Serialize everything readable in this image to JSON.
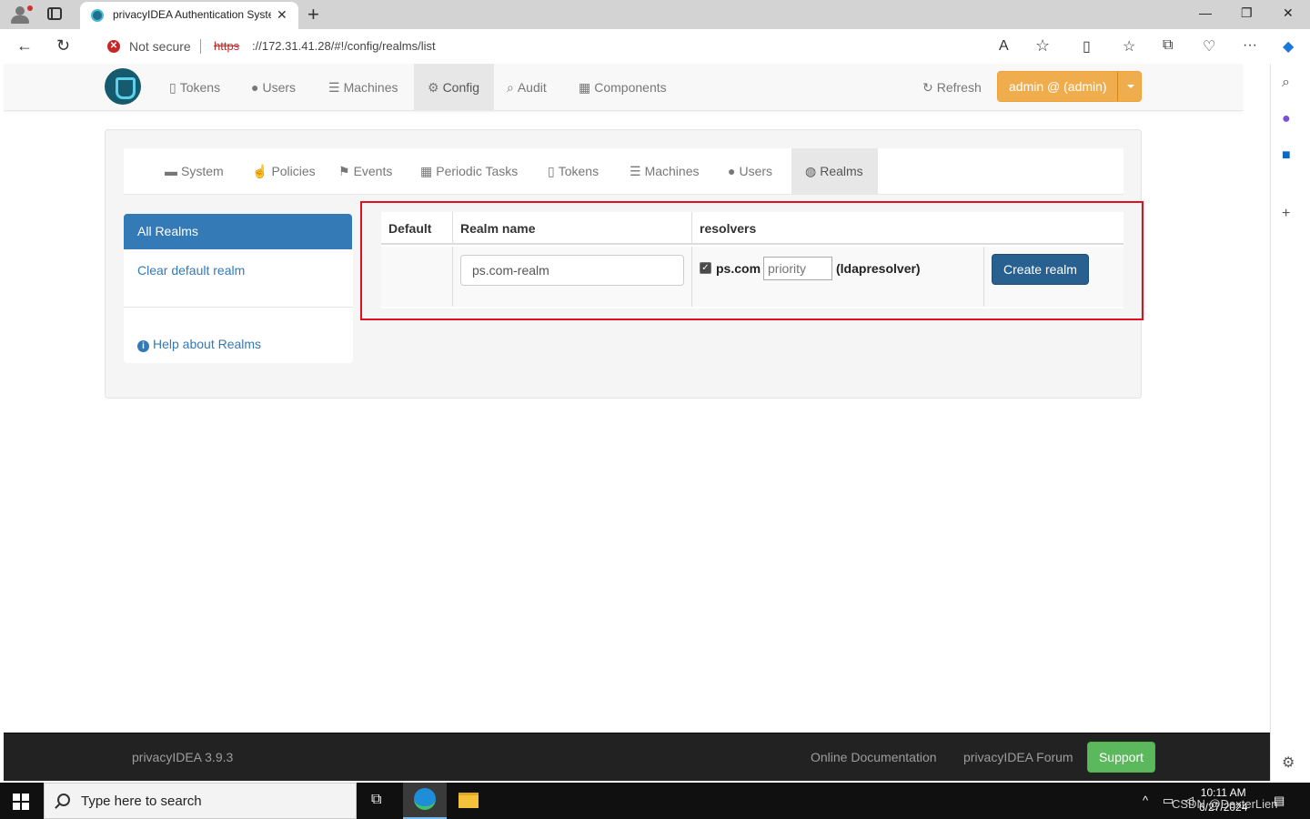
{
  "browser": {
    "tab_title": "privacyIDEA Authentication System",
    "not_secure": "Not secure",
    "url_scheme": "https",
    "url_rest": "://172.31.41.28/#!/config/realms/list"
  },
  "navbar": {
    "items": [
      {
        "label": "Tokens",
        "icon": "mobile-icon"
      },
      {
        "label": "Users",
        "icon": "user-icon"
      },
      {
        "label": "Machines",
        "icon": "list-icon"
      },
      {
        "label": "Config",
        "icon": "gear-icon"
      },
      {
        "label": "Audit",
        "icon": "search-icon"
      },
      {
        "label": "Components",
        "icon": "calendar-icon"
      }
    ],
    "refresh": "Refresh",
    "user": "admin @ (admin)"
  },
  "config_nav": {
    "items": [
      {
        "label": "System",
        "icon": "briefcase-icon"
      },
      {
        "label": "Policies",
        "icon": "hand-icon"
      },
      {
        "label": "Events",
        "icon": "flag-icon"
      },
      {
        "label": "Periodic Tasks",
        "icon": "calendar-icon"
      },
      {
        "label": "Tokens",
        "icon": "mobile-icon"
      },
      {
        "label": "Machines",
        "icon": "list-icon"
      },
      {
        "label": "Users",
        "icon": "user-icon"
      },
      {
        "label": "Realms",
        "icon": "globe-icon"
      }
    ]
  },
  "sidebar": {
    "all_realms": "All Realms",
    "clear_default": "Clear default realm",
    "help": "Help about Realms"
  },
  "realm_table": {
    "headers": [
      "Default",
      "Realm name",
      "resolvers"
    ],
    "realm_name_value": "ps.com-realm",
    "resolver_checked": true,
    "resolver_name": "ps.com",
    "priority_placeholder": "priority",
    "resolver_type": "(ldapresolver)",
    "create_button": "Create realm"
  },
  "footer": {
    "version": "privacyIDEA 3.9.3",
    "docs": "Online Documentation",
    "forum": "privacyIDEA Forum",
    "support": "Support"
  },
  "taskbar": {
    "search_placeholder": "Type here to search",
    "time": "10:11 AM",
    "date": "6/27/2024",
    "watermark": "CSDN @DexterLien"
  }
}
